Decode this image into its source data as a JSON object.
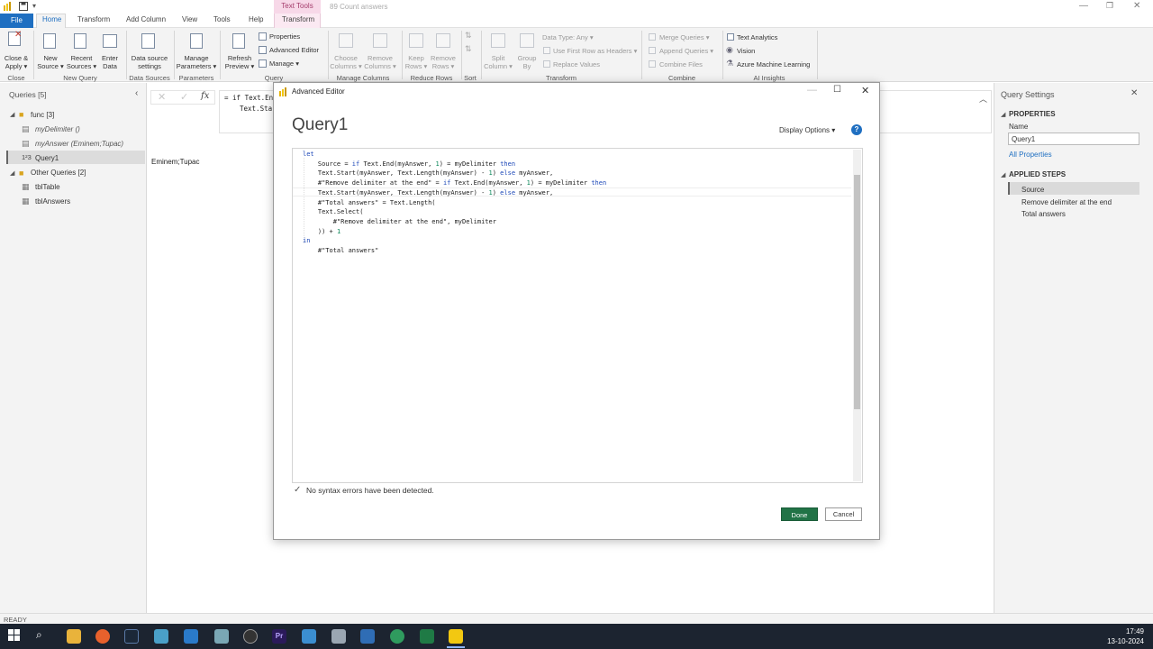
{
  "titlebar": {
    "contextual_tab": "Text Tools",
    "document_title": "89 Count answers"
  },
  "tabs": [
    "File",
    "Home",
    "Transform",
    "Add Column",
    "View",
    "Tools",
    "Help",
    "Transform"
  ],
  "ribbon": {
    "close_apply": "Close &",
    "close_apply2": "Apply",
    "new_source": "New",
    "new_source2": "Source",
    "recent_sources": "Recent",
    "recent_sources2": "Sources",
    "enter_data": "Enter",
    "enter_data2": "Data",
    "data_source_settings": "Data source",
    "data_source_settings2": "settings",
    "manage_parameters": "Manage",
    "manage_parameters2": "Parameters",
    "refresh_preview": "Refresh",
    "refresh_preview2": "Preview",
    "properties": "Properties",
    "advanced_editor": "Advanced Editor",
    "manage": "Manage",
    "choose_columns": "Choose",
    "choose_columns2": "Columns",
    "remove_columns": "Remove",
    "remove_columns2": "Columns",
    "keep_rows": "Keep",
    "keep_rows2": "Rows",
    "remove_rows": "Remove",
    "remove_rows2": "Rows",
    "split_column": "Split",
    "split_column2": "Column",
    "group_by": "Group",
    "group_by2": "By",
    "data_type": "Data Type: Any",
    "use_first_row": "Use First Row as Headers",
    "replace_values": "Replace Values",
    "merge_queries": "Merge Queries",
    "append_queries": "Append Queries",
    "combine_files": "Combine Files",
    "text_analytics": "Text Analytics",
    "vision": "Vision",
    "azure_ml": "Azure Machine Learning",
    "groups": [
      "Close",
      "New Query",
      "Data Sources",
      "Parameters",
      "Query",
      "Manage Columns",
      "Reduce Rows",
      "Sort",
      "Transform",
      "Combine",
      "AI Insights"
    ]
  },
  "queries": {
    "header": "Queries [5]",
    "groups": [
      {
        "name": "func [3]"
      },
      {
        "name": "Other Queries [2]"
      }
    ],
    "items": [
      "myDelimiter ()",
      "myAnswer (Eminem;Tupac)",
      "Query1",
      "tblTable",
      "tblAnswers"
    ],
    "query1_type": "1²3"
  },
  "center": {
    "formula_line1": "= if Text.End",
    "formula_line2": "Text.Star",
    "cell_value": "Eminem;Tupac"
  },
  "settings": {
    "title": "Query Settings",
    "properties": "PROPERTIES",
    "name_label": "Name",
    "name_value": "Query1",
    "all_properties": "All Properties",
    "applied_steps": "APPLIED STEPS",
    "steps": [
      "Source",
      "Remove delimiter at the end",
      "Total answers"
    ]
  },
  "dialog": {
    "title": "Advanced Editor",
    "heading": "Query1",
    "display_options": "Display Options",
    "help": "?",
    "syntax_status": "No syntax errors have been detected.",
    "done": "Done",
    "cancel": "Cancel"
  },
  "status": "READY",
  "clock": {
    "time": "17:49",
    "date": "13-10-2024"
  },
  "colors": {
    "accent_blue": "#1f6fc1",
    "done_green": "#217346",
    "contextual_pink": "#f7d8e8"
  }
}
